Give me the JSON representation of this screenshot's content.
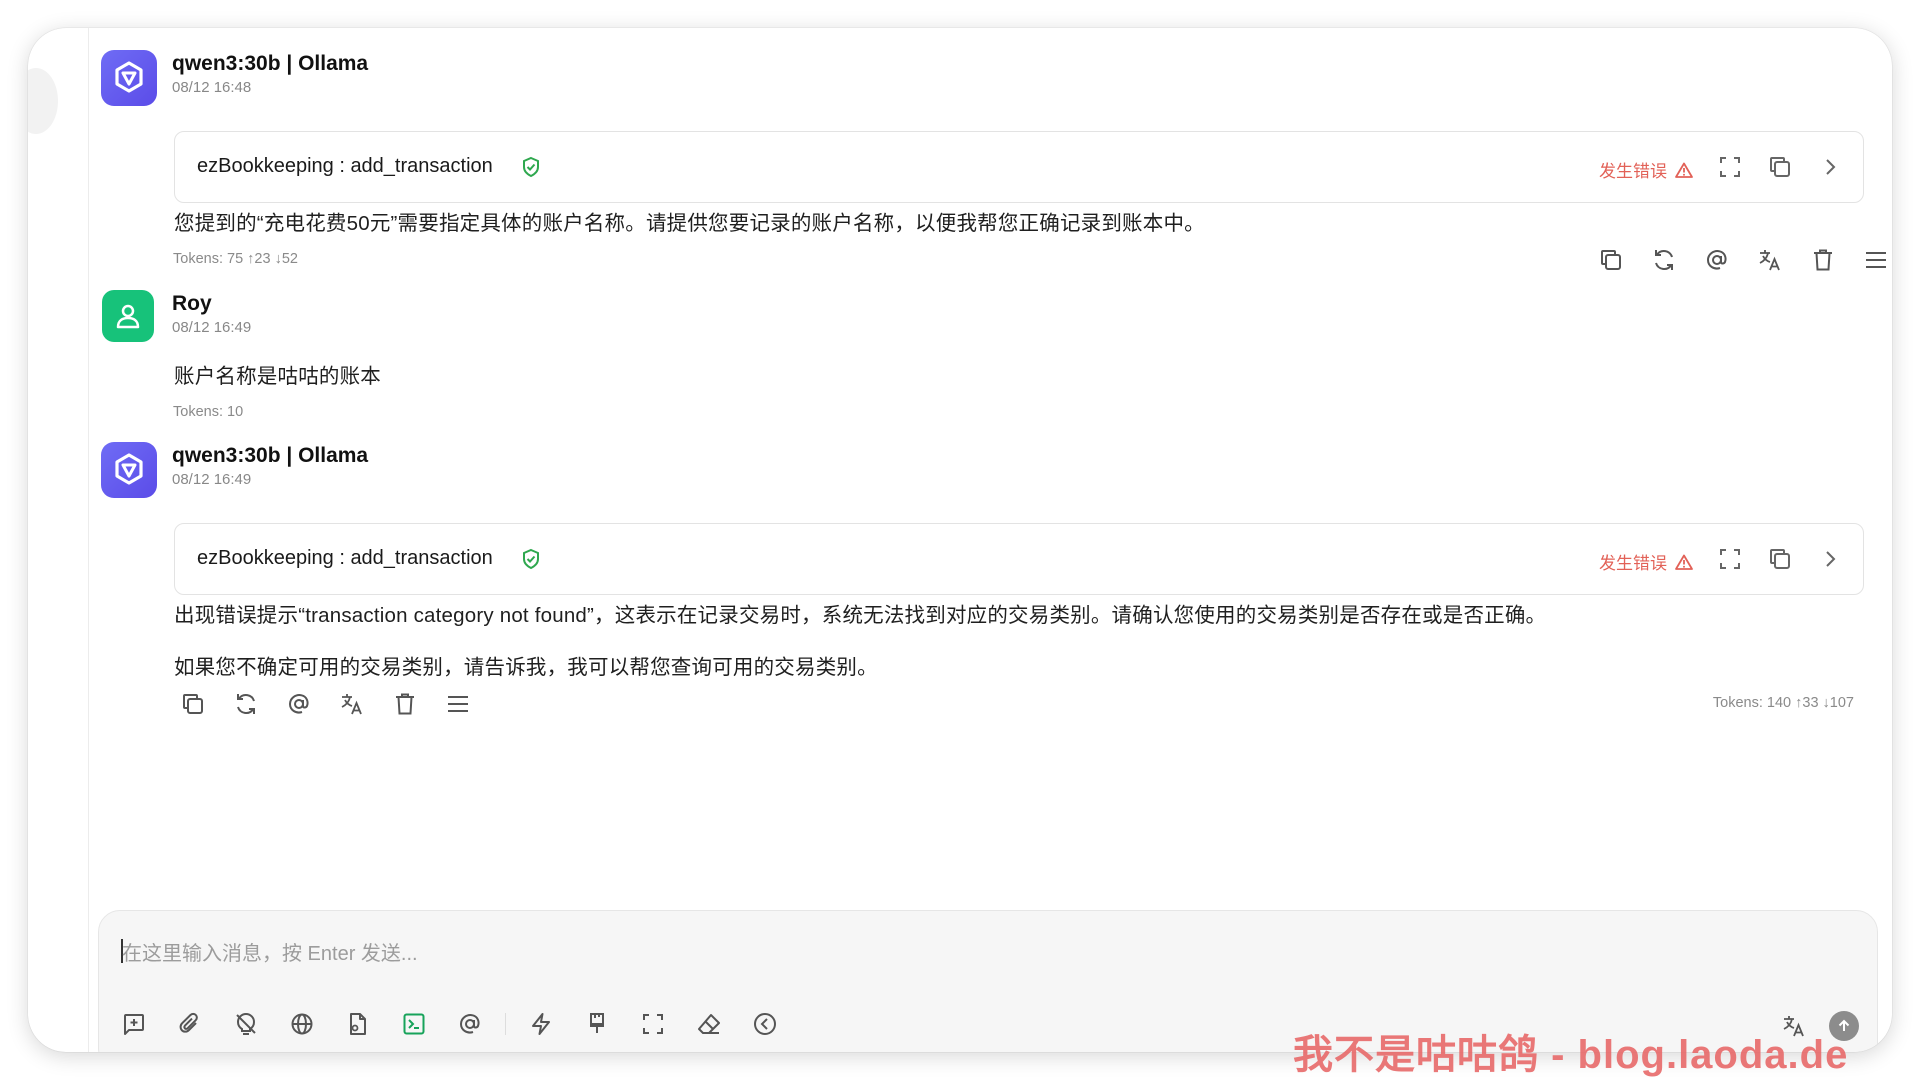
{
  "messages": [
    {
      "model": "qwen3:30b | Ollama",
      "time": "08/12 16:48",
      "tool": {
        "name": "ezBookkeeping : add_transaction",
        "status": "发生错误"
      },
      "text": "您提到的“充电花费50元”需要指定具体的账户名称。请提供您要记录的账户名称，以便我帮您正确记录到账本中。",
      "tokens": "Tokens: 75  ↑23  ↓52"
    },
    {
      "user": "Roy",
      "time": "08/12 16:49",
      "text": "账户名称是咕咕的账本",
      "tokens": "Tokens: 10"
    },
    {
      "model": "qwen3:30b | Ollama",
      "time": "08/12 16:49",
      "tool": {
        "name": "ezBookkeeping : add_transaction",
        "status": "发生错误"
      },
      "text1": "出现错误提示“transaction category not found”，这表示在记录交易时，系统无法找到对应的交易类别。请确认您使用的交易类别是否存在或是否正确。",
      "text2": "如果您不确定可用的交易类别，请告诉我，我可以帮您查询可用的交易类别。",
      "tokens": "Tokens: 140  ↑33  ↓107"
    }
  ],
  "input": {
    "placeholder": "在这里输入消息，按 Enter 发送..."
  },
  "watermark": "我不是咕咕鸽 - blog.laoda.de",
  "colors": {
    "ai_avatar": "#6f6cf5",
    "user_avatar": "#17c27a",
    "error": "#e26157",
    "verified": "#2fa84f",
    "active_tool": "#17a35a"
  }
}
